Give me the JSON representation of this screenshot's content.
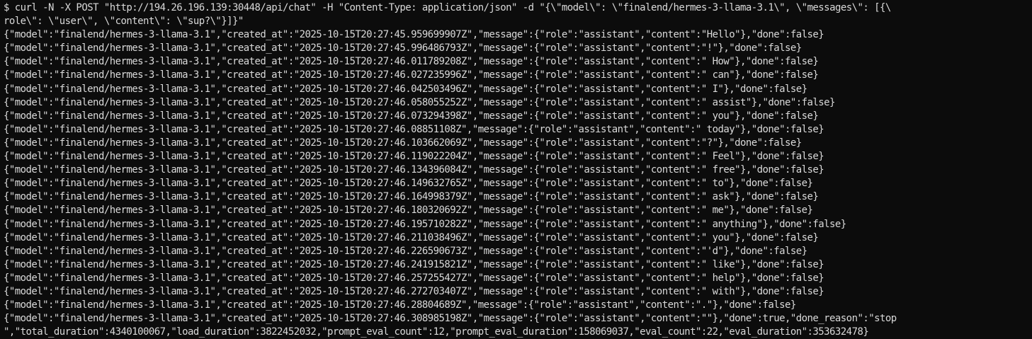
{
  "terminal": {
    "prompt": "$",
    "command_lines": [
      " curl -N -X POST \"http://194.26.196.139:30448/api/chat\" -H \"Content-Type: application/json\" -d \"{\\\"model\\\": \\\"finalend/hermes-3-llama-3.1\\\", \\\"messages\\\": [{\\",
      "role\\\": \\\"user\\\", \\\"content\\\": \\\"sup?\\\"}]}\""
    ],
    "output_lines": [
      "{\"model\":\"finalend/hermes-3-llama-3.1\",\"created_at\":\"2025-10-15T20:27:45.959699907Z\",\"message\":{\"role\":\"assistant\",\"content\":\"Hello\"},\"done\":false}",
      "{\"model\":\"finalend/hermes-3-llama-3.1\",\"created_at\":\"2025-10-15T20:27:45.996486793Z\",\"message\":{\"role\":\"assistant\",\"content\":\"!\"},\"done\":false}",
      "{\"model\":\"finalend/hermes-3-llama-3.1\",\"created_at\":\"2025-10-15T20:27:46.011789208Z\",\"message\":{\"role\":\"assistant\",\"content\":\" How\"},\"done\":false}",
      "{\"model\":\"finalend/hermes-3-llama-3.1\",\"created_at\":\"2025-10-15T20:27:46.027235996Z\",\"message\":{\"role\":\"assistant\",\"content\":\" can\"},\"done\":false}",
      "{\"model\":\"finalend/hermes-3-llama-3.1\",\"created_at\":\"2025-10-15T20:27:46.042503496Z\",\"message\":{\"role\":\"assistant\",\"content\":\" I\"},\"done\":false}",
      "{\"model\":\"finalend/hermes-3-llama-3.1\",\"created_at\":\"2025-10-15T20:27:46.058055252Z\",\"message\":{\"role\":\"assistant\",\"content\":\" assist\"},\"done\":false}",
      "{\"model\":\"finalend/hermes-3-llama-3.1\",\"created_at\":\"2025-10-15T20:27:46.073294398Z\",\"message\":{\"role\":\"assistant\",\"content\":\" you\"},\"done\":false}",
      "{\"model\":\"finalend/hermes-3-llama-3.1\",\"created_at\":\"2025-10-15T20:27:46.08851108Z\",\"message\":{\"role\":\"assistant\",\"content\":\" today\"},\"done\":false}",
      "{\"model\":\"finalend/hermes-3-llama-3.1\",\"created_at\":\"2025-10-15T20:27:46.103662069Z\",\"message\":{\"role\":\"assistant\",\"content\":\"?\"},\"done\":false}",
      "{\"model\":\"finalend/hermes-3-llama-3.1\",\"created_at\":\"2025-10-15T20:27:46.119022204Z\",\"message\":{\"role\":\"assistant\",\"content\":\" Feel\"},\"done\":false}",
      "{\"model\":\"finalend/hermes-3-llama-3.1\",\"created_at\":\"2025-10-15T20:27:46.134396084Z\",\"message\":{\"role\":\"assistant\",\"content\":\" free\"},\"done\":false}",
      "{\"model\":\"finalend/hermes-3-llama-3.1\",\"created_at\":\"2025-10-15T20:27:46.149632765Z\",\"message\":{\"role\":\"assistant\",\"content\":\" to\"},\"done\":false}",
      "{\"model\":\"finalend/hermes-3-llama-3.1\",\"created_at\":\"2025-10-15T20:27:46.164998379Z\",\"message\":{\"role\":\"assistant\",\"content\":\" ask\"},\"done\":false}",
      "{\"model\":\"finalend/hermes-3-llama-3.1\",\"created_at\":\"2025-10-15T20:27:46.180320692Z\",\"message\":{\"role\":\"assistant\",\"content\":\" me\"},\"done\":false}",
      "{\"model\":\"finalend/hermes-3-llama-3.1\",\"created_at\":\"2025-10-15T20:27:46.195710282Z\",\"message\":{\"role\":\"assistant\",\"content\":\" anything\"},\"done\":false}",
      "{\"model\":\"finalend/hermes-3-llama-3.1\",\"created_at\":\"2025-10-15T20:27:46.211038496Z\",\"message\":{\"role\":\"assistant\",\"content\":\" you\"},\"done\":false}",
      "{\"model\":\"finalend/hermes-3-llama-3.1\",\"created_at\":\"2025-10-15T20:27:46.226590673Z\",\"message\":{\"role\":\"assistant\",\"content\":\"'d\"},\"done\":false}",
      "{\"model\":\"finalend/hermes-3-llama-3.1\",\"created_at\":\"2025-10-15T20:27:46.241915821Z\",\"message\":{\"role\":\"assistant\",\"content\":\" like\"},\"done\":false}",
      "{\"model\":\"finalend/hermes-3-llama-3.1\",\"created_at\":\"2025-10-15T20:27:46.257255427Z\",\"message\":{\"role\":\"assistant\",\"content\":\" help\"},\"done\":false}",
      "{\"model\":\"finalend/hermes-3-llama-3.1\",\"created_at\":\"2025-10-15T20:27:46.272703407Z\",\"message\":{\"role\":\"assistant\",\"content\":\" with\"},\"done\":false}",
      "{\"model\":\"finalend/hermes-3-llama-3.1\",\"created_at\":\"2025-10-15T20:27:46.28804689Z\",\"message\":{\"role\":\"assistant\",\"content\":\".\"},\"done\":false}",
      "{\"model\":\"finalend/hermes-3-llama-3.1\",\"created_at\":\"2025-10-15T20:27:46.308985198Z\",\"message\":{\"role\":\"assistant\",\"content\":\"\"},\"done\":true,\"done_reason\":\"stop",
      "\",\"total_duration\":4340100067,\"load_duration\":3822452032,\"prompt_eval_count\":12,\"prompt_eval_duration\":158069037,\"eval_count\":22,\"eval_duration\":353632478}"
    ],
    "colors": {
      "background": "#0c0c0c",
      "foreground": "#d9d9d9"
    }
  }
}
